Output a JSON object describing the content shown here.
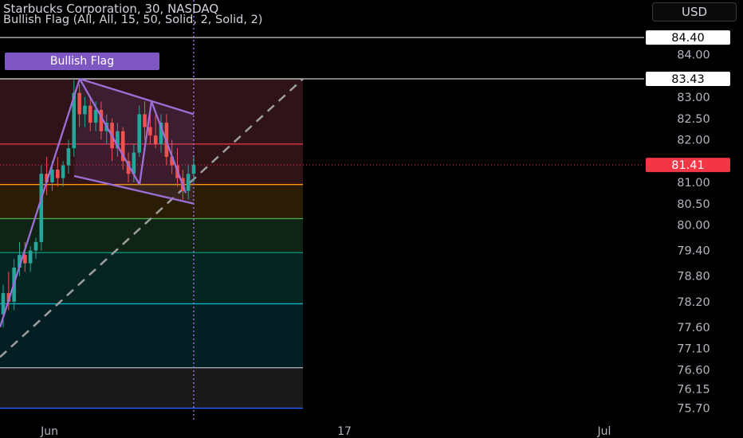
{
  "header": {
    "title": "Starbucks Corporation, 30, NASDAQ",
    "indicator": "Bullish Flag (All, All, 15, 50, Solid, 2, Solid, 2)",
    "currency": "USD"
  },
  "pattern_label": "Bullish Flag",
  "colors": {
    "background": "#000000",
    "up_candle": "#26a69a",
    "down_candle": "#ef5350",
    "pattern": "#9c6fd6",
    "trend_line": "#9e9e9e",
    "last_price_badge": "#f23645"
  },
  "chart_data": {
    "type": "candlestick",
    "title": "Starbucks Corporation, 30, NASDAQ",
    "y_ticks": [
      "84.00",
      "83.00",
      "82.50",
      "82.00",
      "81.00",
      "80.50",
      "80.00",
      "79.40",
      "78.80",
      "78.20",
      "77.60",
      "77.10",
      "76.60",
      "76.15",
      "75.70"
    ],
    "x_ticks": [
      "Jun",
      "17",
      "Jul"
    ],
    "price_markers": [
      {
        "label": "84.40",
        "value": 84.4,
        "style": "horizontal-line"
      },
      {
        "label": "83.43",
        "value": 83.43,
        "style": "horizontal-line"
      },
      {
        "label": "81.41",
        "value": 81.41,
        "style": "last-price"
      }
    ],
    "fib_levels": [
      {
        "value": 83.43,
        "color": "#b2b5be",
        "zone": "#2e1418"
      },
      {
        "value": 81.9,
        "color": "#f23645",
        "zone": "#301316"
      },
      {
        "value": 80.95,
        "color": "#ff9800",
        "zone": "#2b1c06"
      },
      {
        "value": 80.15,
        "color": "#4caf50",
        "zone": "#0f2414"
      },
      {
        "value": 79.35,
        "color": "#089981",
        "zone": "#062522"
      },
      {
        "value": 78.15,
        "color": "#00bcd4",
        "zone": "#041f23"
      },
      {
        "value": 76.65,
        "color": "#b2b5be",
        "zone": "#191919"
      },
      {
        "value": 75.7,
        "color": "#2962ff",
        "zone": "#0a1a3c"
      }
    ],
    "pattern_lines": [
      {
        "x1": 0,
        "y1": 77.6,
        "x2": 100,
        "y2": 83.43
      },
      {
        "x1": 100,
        "y1": 83.43,
        "x2": 243,
        "y2": 82.6
      },
      {
        "x1": 93,
        "y1": 81.15,
        "x2": 243,
        "y2": 80.5
      },
      {
        "x1": 100,
        "y1": 83.43,
        "x2": 175,
        "y2": 80.95
      },
      {
        "x1": 175,
        "y1": 80.95,
        "x2": 190,
        "y2": 82.9
      },
      {
        "x1": 190,
        "y1": 82.9,
        "x2": 233,
        "y2": 80.75
      }
    ],
    "trend_line": {
      "x1": 0,
      "y1": 76.9,
      "x2": 380,
      "y2": 83.43
    },
    "candles": [
      {
        "o": 77.9,
        "h": 78.6,
        "l": 77.6,
        "c": 78.4
      },
      {
        "o": 78.4,
        "h": 78.9,
        "l": 78.0,
        "c": 78.2
      },
      {
        "o": 78.2,
        "h": 79.2,
        "l": 78.0,
        "c": 79.0
      },
      {
        "o": 79.0,
        "h": 79.6,
        "l": 78.8,
        "c": 79.3
      },
      {
        "o": 79.3,
        "h": 79.6,
        "l": 78.9,
        "c": 79.1
      },
      {
        "o": 79.1,
        "h": 79.5,
        "l": 78.9,
        "c": 79.4
      },
      {
        "o": 79.4,
        "h": 79.7,
        "l": 79.2,
        "c": 79.6
      },
      {
        "o": 79.6,
        "h": 81.4,
        "l": 79.4,
        "c": 81.2
      },
      {
        "o": 81.2,
        "h": 81.6,
        "l": 80.7,
        "c": 81.0
      },
      {
        "o": 81.0,
        "h": 81.5,
        "l": 80.8,
        "c": 81.3
      },
      {
        "o": 81.3,
        "h": 81.6,
        "l": 80.9,
        "c": 81.1
      },
      {
        "o": 81.1,
        "h": 81.5,
        "l": 80.9,
        "c": 81.4
      },
      {
        "o": 81.4,
        "h": 82.0,
        "l": 81.2,
        "c": 81.8
      },
      {
        "o": 81.8,
        "h": 83.4,
        "l": 81.6,
        "c": 83.1
      },
      {
        "o": 83.1,
        "h": 83.3,
        "l": 82.3,
        "c": 82.6
      },
      {
        "o": 82.6,
        "h": 83.0,
        "l": 82.3,
        "c": 82.8
      },
      {
        "o": 82.8,
        "h": 83.0,
        "l": 82.2,
        "c": 82.4
      },
      {
        "o": 82.4,
        "h": 82.9,
        "l": 82.2,
        "c": 82.7
      },
      {
        "o": 82.7,
        "h": 82.9,
        "l": 82.0,
        "c": 82.2
      },
      {
        "o": 82.2,
        "h": 82.6,
        "l": 81.9,
        "c": 82.4
      },
      {
        "o": 82.4,
        "h": 82.5,
        "l": 81.5,
        "c": 81.8
      },
      {
        "o": 81.8,
        "h": 82.4,
        "l": 81.6,
        "c": 82.2
      },
      {
        "o": 82.2,
        "h": 82.3,
        "l": 81.3,
        "c": 81.5
      },
      {
        "o": 81.5,
        "h": 81.7,
        "l": 81.0,
        "c": 81.2
      },
      {
        "o": 81.2,
        "h": 81.9,
        "l": 81.0,
        "c": 81.7
      },
      {
        "o": 81.7,
        "h": 82.8,
        "l": 81.6,
        "c": 82.6
      },
      {
        "o": 82.6,
        "h": 82.9,
        "l": 82.0,
        "c": 82.3
      },
      {
        "o": 82.3,
        "h": 82.6,
        "l": 81.9,
        "c": 82.1
      },
      {
        "o": 82.1,
        "h": 82.6,
        "l": 81.8,
        "c": 81.9
      },
      {
        "o": 81.9,
        "h": 82.6,
        "l": 81.7,
        "c": 82.4
      },
      {
        "o": 82.4,
        "h": 82.6,
        "l": 81.4,
        "c": 81.6
      },
      {
        "o": 81.6,
        "h": 82.0,
        "l": 81.2,
        "c": 81.4
      },
      {
        "o": 81.4,
        "h": 81.8,
        "l": 80.9,
        "c": 81.1
      },
      {
        "o": 81.1,
        "h": 81.3,
        "l": 80.6,
        "c": 80.8
      },
      {
        "o": 80.8,
        "h": 81.4,
        "l": 80.6,
        "c": 81.2
      },
      {
        "o": 81.2,
        "h": 81.6,
        "l": 81.0,
        "c": 81.41
      }
    ]
  }
}
